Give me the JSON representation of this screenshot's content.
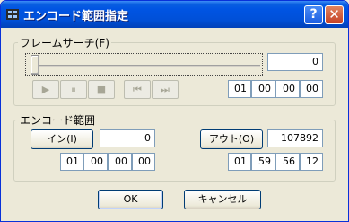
{
  "window": {
    "title": "エンコード範囲指定",
    "help_label": "?",
    "close_label": "✕"
  },
  "frame_search": {
    "legend": "フレームサーチ(F)",
    "frame_value": "0",
    "player_buttons": [
      "▶",
      "⏸",
      "■",
      "⏮",
      "⏭"
    ],
    "timecode": [
      "01",
      "00",
      "00",
      "00"
    ]
  },
  "encode_range": {
    "legend": "エンコード範囲",
    "in_button": "イン(I)",
    "in_value": "0",
    "in_timecode": [
      "01",
      "00",
      "00",
      "00"
    ],
    "out_button": "アウト(O)",
    "out_value": "107892",
    "out_timecode": [
      "01",
      "59",
      "56",
      "12"
    ]
  },
  "buttons": {
    "ok": "OK",
    "cancel": "キャンセル"
  },
  "colors": {
    "titlebar": "#0054e3",
    "face": "#ece9d8",
    "close": "#c44125"
  }
}
